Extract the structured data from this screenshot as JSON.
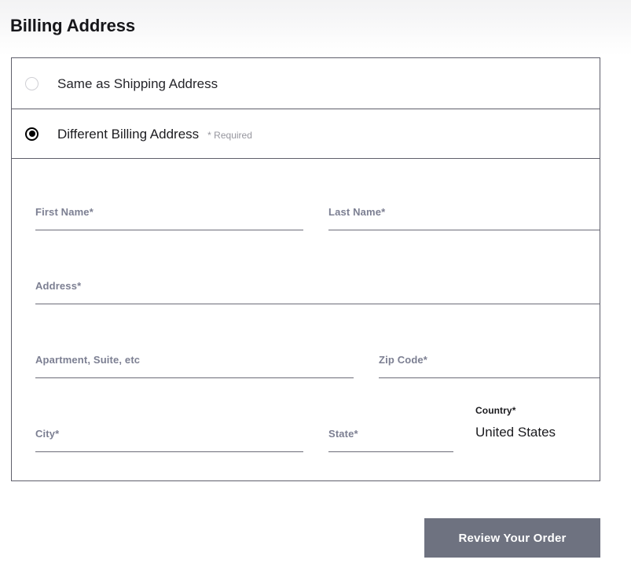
{
  "page": {
    "title": "Billing Address"
  },
  "address_choice": {
    "options": [
      {
        "label": "Same as Shipping Address",
        "selected": false,
        "note": ""
      },
      {
        "label": "Different Billing Address",
        "selected": true,
        "note": "* Required"
      }
    ]
  },
  "form": {
    "fields": [
      {
        "label": "First Name*",
        "value": ""
      },
      {
        "label": "Last Name*",
        "value": ""
      },
      {
        "label": "Address*",
        "value": ""
      },
      {
        "label": "Apartment, Suite, etc",
        "value": ""
      },
      {
        "label": "Zip Code*",
        "value": ""
      },
      {
        "label": "City*",
        "value": ""
      },
      {
        "label": "State*",
        "value": ""
      }
    ],
    "country": {
      "label": "Country*",
      "value": "United States"
    }
  },
  "actions": {
    "review_label": "Review Your Order"
  },
  "colors": {
    "panel_border": "#5f5f6b",
    "field_label": "#7c7f92",
    "field_underline": "#6c6c78",
    "button_bg": "#6e7280",
    "button_text": "#ffffff",
    "title_text": "#16161a",
    "required_note": "#96969e"
  }
}
